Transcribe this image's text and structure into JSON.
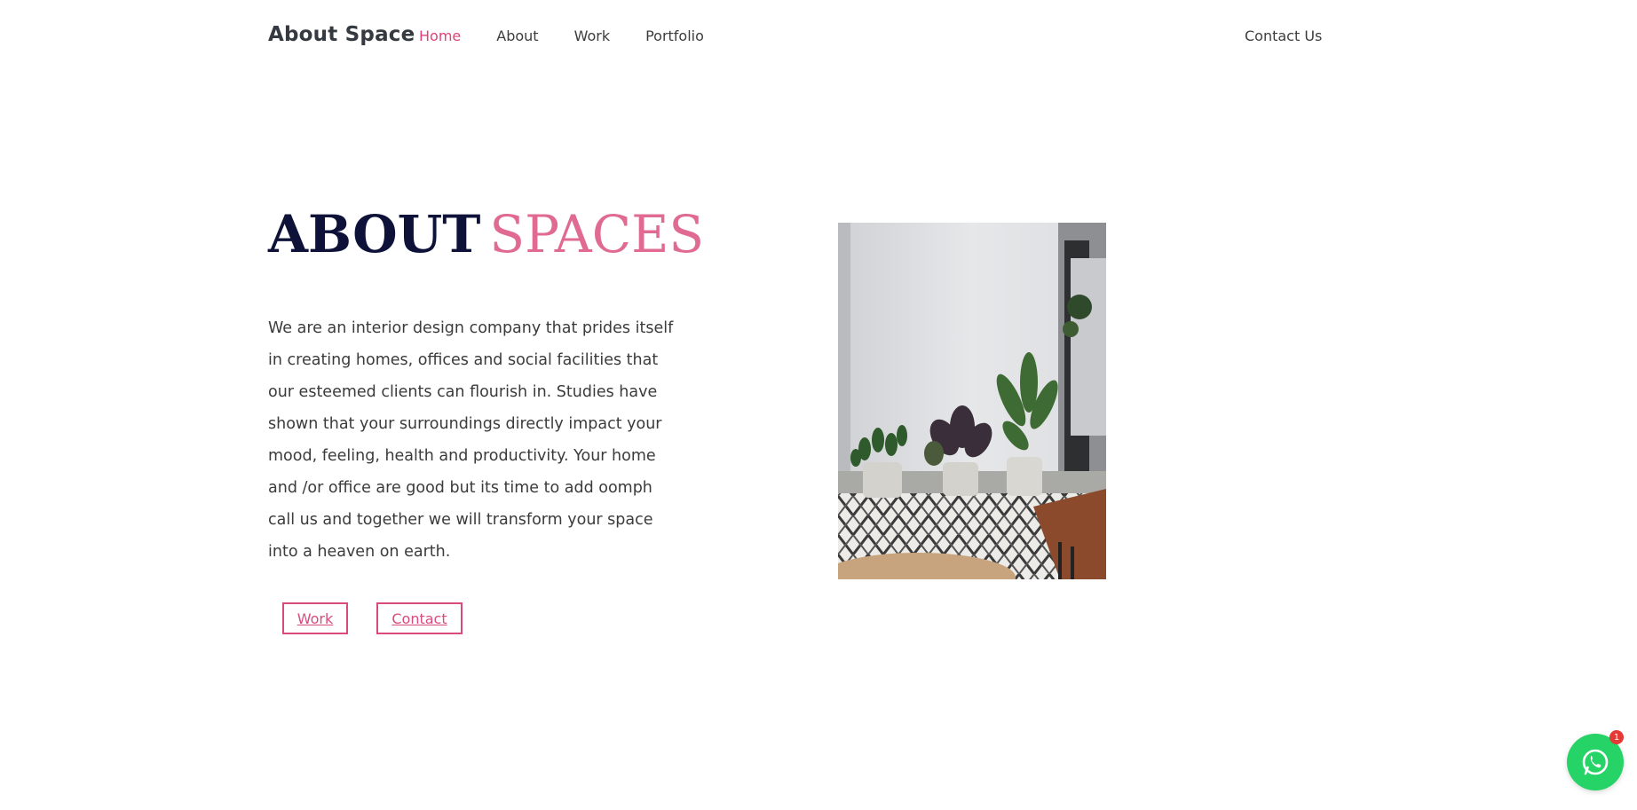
{
  "header": {
    "brand": "About Space",
    "nav": [
      "Home",
      "About",
      "Work",
      "Portfolio"
    ],
    "active_nav": "Home",
    "contact_label": "Contact Us"
  },
  "hero": {
    "title_part1": "ABOUT",
    "title_part2": "SPACES",
    "description": "We are an interior design company that prides itself in creating homes, offices and social facilities that our esteemed clients can flourish in. Studies have shown that your surroundings directly impact your mood, feeling, health and productivity. Your home and /or office are good but its time to add oomph call us and together we will transform your space into a heaven on earth.",
    "buttons": {
      "work": "Work",
      "contact": "Contact"
    },
    "image_subject": "interior room with potted plants on patterned rug"
  },
  "chat_widget": {
    "icon": "whatsapp-icon",
    "badge_count": "1"
  },
  "colors": {
    "accent": "#e3407a",
    "title_dark": "#0e1238",
    "title_pink": "#e06a91",
    "whatsapp_green": "#25d366",
    "badge_red": "#e53935"
  }
}
